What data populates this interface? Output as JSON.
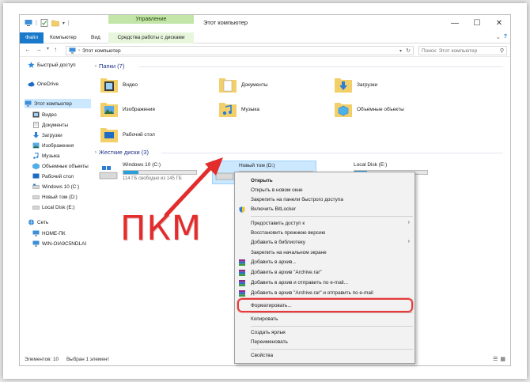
{
  "window": {
    "title": "Этот компьютер",
    "contextual_tab_header": "Управление",
    "controls": {
      "minimize": "—",
      "maximize": "☐",
      "close": "✕"
    }
  },
  "ribbon": {
    "tabs": [
      "Файл",
      "Компьютер",
      "Вид",
      "Средства работы с дисками"
    ],
    "expand_glyph": "⌄",
    "help_glyph": "?"
  },
  "address": {
    "path": "Этот компьютер",
    "search_placeholder": "Поиск: Этот компьютер"
  },
  "nav": {
    "items": [
      {
        "label": "Быстрый доступ",
        "icon": "star-icon"
      },
      {
        "label": "OneDrive",
        "icon": "cloud-icon"
      },
      {
        "label": "Этот компьютер",
        "icon": "computer-icon"
      },
      {
        "label": "Видео",
        "icon": "video-folder-icon"
      },
      {
        "label": "Документы",
        "icon": "documents-folder-icon"
      },
      {
        "label": "Загрузки",
        "icon": "downloads-icon"
      },
      {
        "label": "Изображения",
        "icon": "pictures-folder-icon"
      },
      {
        "label": "Музыка",
        "icon": "music-icon"
      },
      {
        "label": "Объемные объекты",
        "icon": "3d-objects-icon"
      },
      {
        "label": "Рабочий стол",
        "icon": "desktop-icon"
      },
      {
        "label": "Windows 10 (C:)",
        "icon": "drive-icon"
      },
      {
        "label": "Новый том (D:)",
        "icon": "drive-icon"
      },
      {
        "label": "Local Disk (E:)",
        "icon": "drive-icon"
      },
      {
        "label": "Сеть",
        "icon": "network-icon"
      },
      {
        "label": "HOME-ПК",
        "icon": "computer-icon"
      },
      {
        "label": "WIN-OIA9C5NDLAI",
        "icon": "computer-icon"
      }
    ]
  },
  "content": {
    "folders_header": "Папки (7)",
    "folders": [
      "Видео",
      "Документы",
      "Загрузки",
      "Изображения",
      "Музыка",
      "Объемные объекты",
      "Рабочий стол"
    ],
    "drives_header": "Жесткие диски (3)",
    "drives": [
      {
        "name": "Windows 10 (C:)",
        "free": "114 ГБ свободно из 145 ГБ",
        "used_fraction": 0.21
      },
      {
        "name": "Новый том (D:)",
        "free": "",
        "used_fraction": 0.0
      },
      {
        "name": "Local Disk (E:)",
        "free": "",
        "used_fraction": 0.17
      }
    ]
  },
  "annotation": {
    "label": "ПКМ"
  },
  "context_menu": {
    "items": [
      "Открыть",
      "Открыть в новом окне",
      "Закрепить на панели быстрого доступа",
      "Включить BitLocker",
      "Предоставить доступ к",
      "Восстановить прежнюю версию",
      "Добавить в библиотеку",
      "Закрепить на начальном экране",
      "Добавить в архив...",
      "Добавить в архив \"Archive.rar\"",
      "Добавить в архив и отправить по e-mail...",
      "Добавить в архив \"Archive.rar\" и отправить по e-mail",
      "Форматировать...",
      "Копировать",
      "Создать ярлык",
      "Переименовать",
      "Свойства"
    ],
    "submenu_glyph": "›"
  },
  "status": {
    "items_count": "Элементов: 10",
    "selected": "Выбран 1 элемент"
  },
  "colors": {
    "accent": "#1979ca",
    "selection": "#cce8ff",
    "contextual_tab": "#c3e6a8",
    "annotation_red": "#e32c2c",
    "drive_fill": "#26a0da"
  }
}
